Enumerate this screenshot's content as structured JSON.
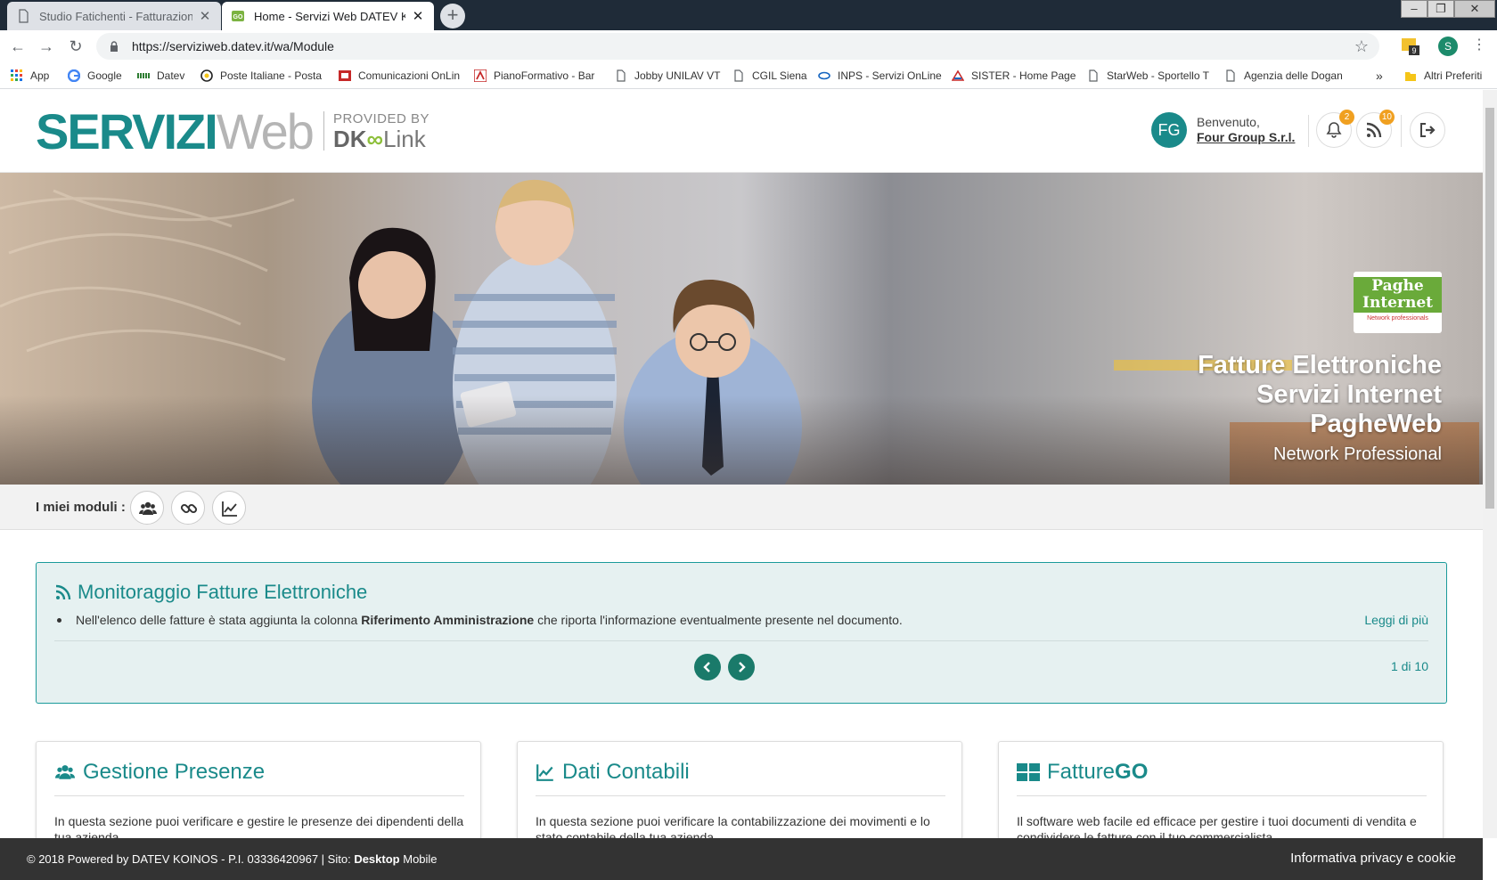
{
  "browser": {
    "tabs": [
      {
        "title": "Studio Fatichenti - Fatturazione E",
        "active": false
      },
      {
        "title": "Home - Servizi Web DATEV KOINOS",
        "active": true
      }
    ],
    "address": "https://serviziweb.datev.it/wa/Module",
    "profile_initial": "S",
    "extension_badge": "9",
    "bookmarks": [
      {
        "label": "App",
        "icon": "apps-grid-icon"
      },
      {
        "label": "Google",
        "icon": "google-icon"
      },
      {
        "label": "Datev",
        "icon": "datev-icon"
      },
      {
        "label": "Poste Italiane - Posta",
        "icon": "poste-icon"
      },
      {
        "label": "Comunicazioni OnLin",
        "icon": "comunicazioni-icon"
      },
      {
        "label": "PianoFormativo - Bar",
        "icon": "pianoformativo-icon"
      },
      {
        "label": "Jobby UNILAV VT",
        "icon": "page-icon"
      },
      {
        "label": "CGIL Siena",
        "icon": "page-icon"
      },
      {
        "label": "INPS - Servizi OnLine",
        "icon": "inps-icon"
      },
      {
        "label": "SISTER - Home Page",
        "icon": "sister-icon"
      },
      {
        "label": "StarWeb - Sportello T",
        "icon": "page-icon"
      },
      {
        "label": "Agenzia delle Dogan",
        "icon": "page-icon"
      }
    ],
    "bookmarks_overflow": "»",
    "other_bookmarks": "Altri Preferiti"
  },
  "header": {
    "logo_main": "SERVIZI",
    "logo_secondary": "Web",
    "provided_by": "PROVIDED BY",
    "provider_dk": "DK",
    "provider_link": "Link",
    "user_initials": "FG",
    "welcome": "Benvenuto,",
    "company": "Four Group S.r.l.",
    "notifications_count": "2",
    "feed_count": "10"
  },
  "hero": {
    "logo_line1": "Paghe Internet",
    "logo_line2": "Network professionals",
    "line1": "Fatture Elettroniche",
    "line2": "Servizi Internet",
    "line3": "PagheWeb",
    "subtitle": "Network Professional"
  },
  "modules": {
    "label": "I miei moduli :",
    "icons": [
      "users-icon",
      "link-icon",
      "chart-line-icon"
    ]
  },
  "news": {
    "title": "Monitoraggio Fatture Elettroniche",
    "text_before": "Nell'elenco delle fatture è stata aggiunta la colonna",
    "text_bold": "Riferimento Amministrazione",
    "text_after": "che riporta l'informazione eventualmente presente nel documento.",
    "more": "Leggi di più",
    "pager": "1 di 10"
  },
  "cards": [
    {
      "title": "Gestione Presenze",
      "desc": "In questa sezione puoi verificare e gestire le presenze dei dipendenti della tua azienda."
    },
    {
      "title": "Dati Contabili",
      "desc": "In questa sezione puoi verificare la contabilizzazione dei movimenti e lo stato contabile della tua azienda."
    },
    {
      "title_plain": "Fatture",
      "title_bold": "GO",
      "desc": "Il software web facile ed efficace per gestire i tuoi documenti di vendita e condividere le fatture con il tuo commercialista."
    }
  ],
  "footer": {
    "copyright": "© 2018 Powered by DATEV KOINOS - P.I. 03336420967 | Sito:",
    "desktop": "Desktop",
    "mobile": "Mobile",
    "privacy": "Informativa privacy e cookie"
  },
  "colors": {
    "brand_teal": "#1a8a8a",
    "badge_orange": "#f0a020",
    "footer_bg": "#333333",
    "news_bg": "#e6f1f1"
  }
}
